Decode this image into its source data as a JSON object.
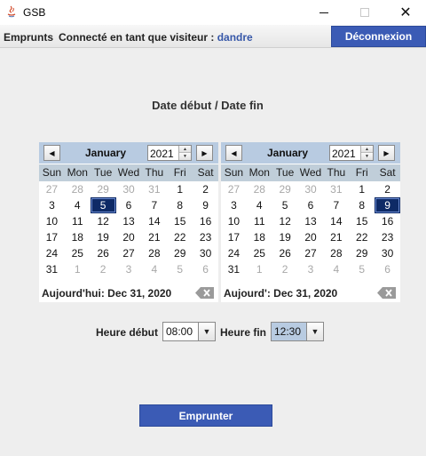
{
  "window": {
    "title": "GSB"
  },
  "menubar": {
    "menu_label": "Emprunts",
    "status_prefix": "Connecté en tant que visiteur : ",
    "username": "dandre",
    "logout_label": "Déconnexion"
  },
  "heading": "Date début / Date fin",
  "calendars": {
    "weekdays": [
      "Sun",
      "Mon",
      "Tue",
      "Wed",
      "Thu",
      "Fri",
      "Sat"
    ],
    "start": {
      "month": "January",
      "year": "2021",
      "days": [
        {
          "d": "27",
          "other": true
        },
        {
          "d": "28",
          "other": true
        },
        {
          "d": "29",
          "other": true
        },
        {
          "d": "30",
          "other": true
        },
        {
          "d": "31",
          "other": true
        },
        {
          "d": "1"
        },
        {
          "d": "2"
        },
        {
          "d": "3"
        },
        {
          "d": "4"
        },
        {
          "d": "5",
          "selected": true
        },
        {
          "d": "6"
        },
        {
          "d": "7"
        },
        {
          "d": "8"
        },
        {
          "d": "9"
        },
        {
          "d": "10"
        },
        {
          "d": "11"
        },
        {
          "d": "12"
        },
        {
          "d": "13"
        },
        {
          "d": "14"
        },
        {
          "d": "15"
        },
        {
          "d": "16"
        },
        {
          "d": "17"
        },
        {
          "d": "18"
        },
        {
          "d": "19"
        },
        {
          "d": "20"
        },
        {
          "d": "21"
        },
        {
          "d": "22"
        },
        {
          "d": "23"
        },
        {
          "d": "24"
        },
        {
          "d": "25"
        },
        {
          "d": "26"
        },
        {
          "d": "27"
        },
        {
          "d": "28"
        },
        {
          "d": "29"
        },
        {
          "d": "30"
        },
        {
          "d": "31"
        },
        {
          "d": "1",
          "other": true
        },
        {
          "d": "2",
          "other": true
        },
        {
          "d": "3",
          "other": true
        },
        {
          "d": "4",
          "other": true
        },
        {
          "d": "5",
          "other": true
        },
        {
          "d": "6",
          "other": true
        }
      ],
      "today_text": "Aujourd'hui: Dec 31, 2020"
    },
    "end": {
      "month": "January",
      "year": "2021",
      "days": [
        {
          "d": "27",
          "other": true
        },
        {
          "d": "28",
          "other": true
        },
        {
          "d": "29",
          "other": true
        },
        {
          "d": "30",
          "other": true
        },
        {
          "d": "31",
          "other": true
        },
        {
          "d": "1"
        },
        {
          "d": "2"
        },
        {
          "d": "3"
        },
        {
          "d": "4"
        },
        {
          "d": "5"
        },
        {
          "d": "6"
        },
        {
          "d": "7"
        },
        {
          "d": "8"
        },
        {
          "d": "9",
          "selected": true
        },
        {
          "d": "10"
        },
        {
          "d": "11"
        },
        {
          "d": "12"
        },
        {
          "d": "13"
        },
        {
          "d": "14"
        },
        {
          "d": "15"
        },
        {
          "d": "16"
        },
        {
          "d": "17"
        },
        {
          "d": "18"
        },
        {
          "d": "19"
        },
        {
          "d": "20"
        },
        {
          "d": "21"
        },
        {
          "d": "22"
        },
        {
          "d": "23"
        },
        {
          "d": "24"
        },
        {
          "d": "25"
        },
        {
          "d": "26"
        },
        {
          "d": "27"
        },
        {
          "d": "28"
        },
        {
          "d": "29"
        },
        {
          "d": "30"
        },
        {
          "d": "31"
        },
        {
          "d": "1",
          "other": true
        },
        {
          "d": "2",
          "other": true
        },
        {
          "d": "3",
          "other": true
        },
        {
          "d": "4",
          "other": true
        },
        {
          "d": "5",
          "other": true
        },
        {
          "d": "6",
          "other": true
        }
      ],
      "today_text": "Aujourd': Dec 31, 2020"
    }
  },
  "time": {
    "start_label": "Heure début",
    "start_value": "08:00",
    "end_label": "Heure fin",
    "end_value": "12:30"
  },
  "borrow_label": "Emprunter",
  "colors": {
    "accent": "#3b5bb5",
    "calendar_header": "#b8cbe1",
    "selected_day": "#0e2a66",
    "username": "#3657a8"
  }
}
